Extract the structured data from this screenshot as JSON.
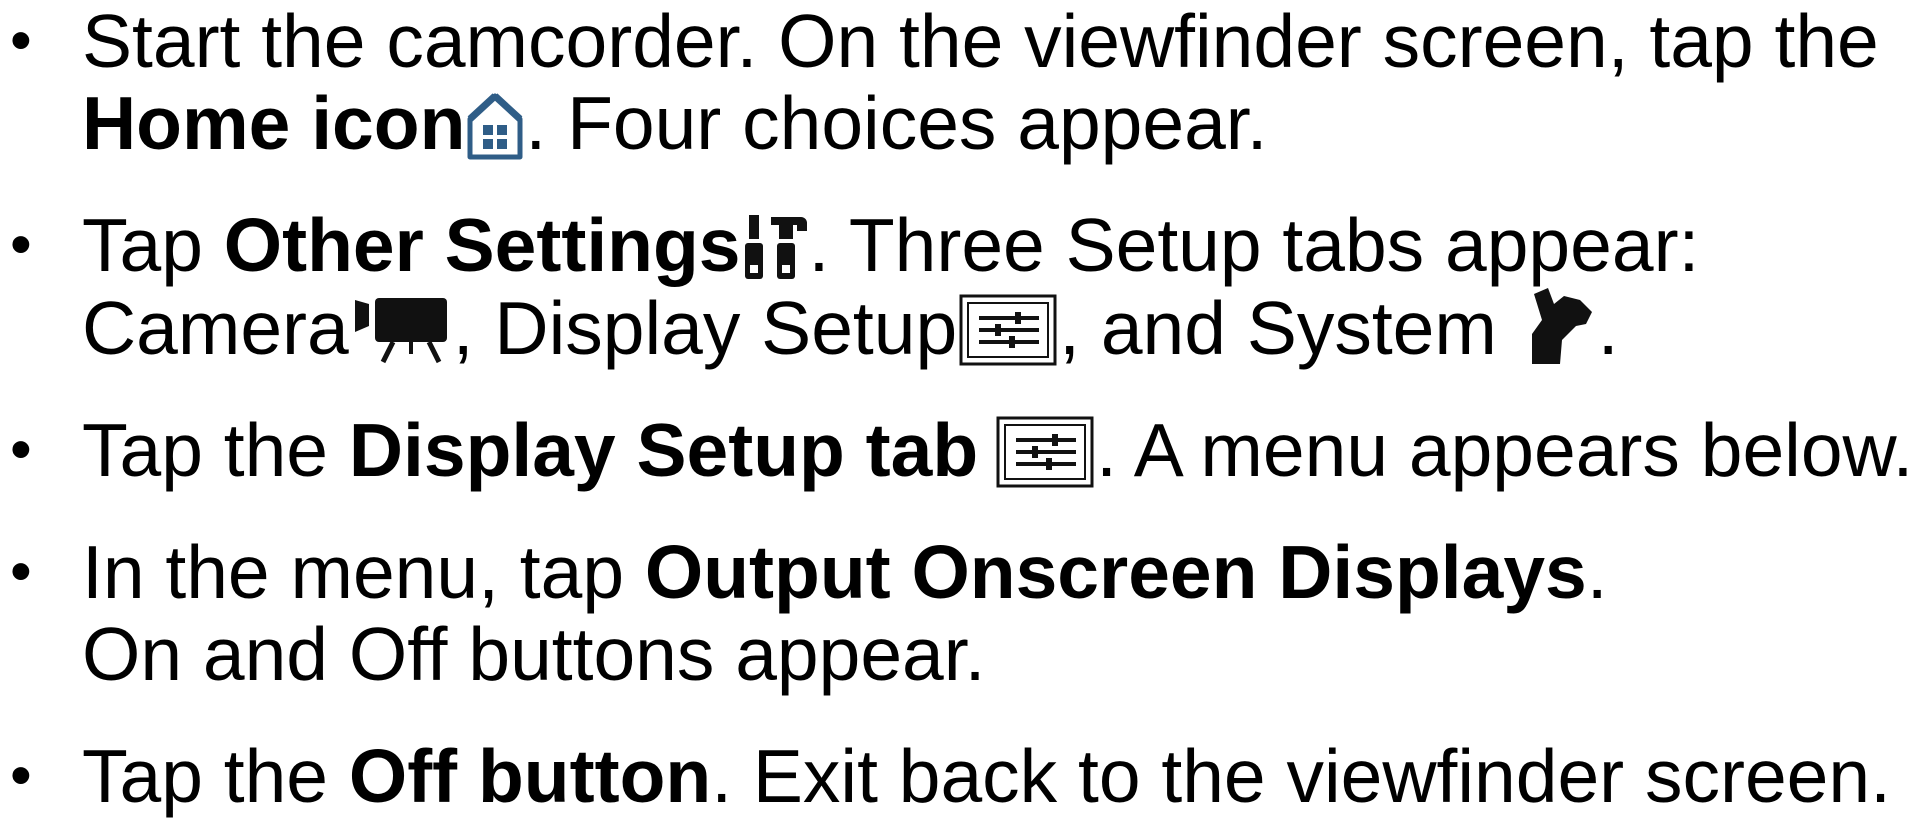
{
  "icons": {
    "home": "home-icon",
    "other_settings": "other-settings-icon",
    "camera": "camera-icon",
    "display_setup": "display-setup-sliders-icon",
    "system": "system-wrench-icon"
  },
  "colors": {
    "home_icon": "#2f5d87",
    "text": "#000000",
    "icon_dark": "#111111"
  },
  "bullet": "•",
  "steps": [
    {
      "t1": "Start the camcorder. On the viewfinder screen, tap the",
      "b1": "Home icon",
      "t2": ". Four choices appear."
    },
    {
      "t1": "Tap ",
      "b1": "Other Settings",
      "t2": ". Three Setup tabs appear:",
      "t3": "Camera",
      "t4": ", Display Setup",
      "t5": ", and System ",
      "t6": "."
    },
    {
      "t1": "Tap the ",
      "b1": "Display Setup tab",
      "t2": ". A menu appears below."
    },
    {
      "t1": "In the menu, tap ",
      "b1": "Output Onscreen Displays",
      "t2": ".",
      "t3": "On and Off buttons appear."
    },
    {
      "t1": "Tap the ",
      "b1": "Off button",
      "t2": ". Exit back to the viewfinder screen."
    }
  ]
}
